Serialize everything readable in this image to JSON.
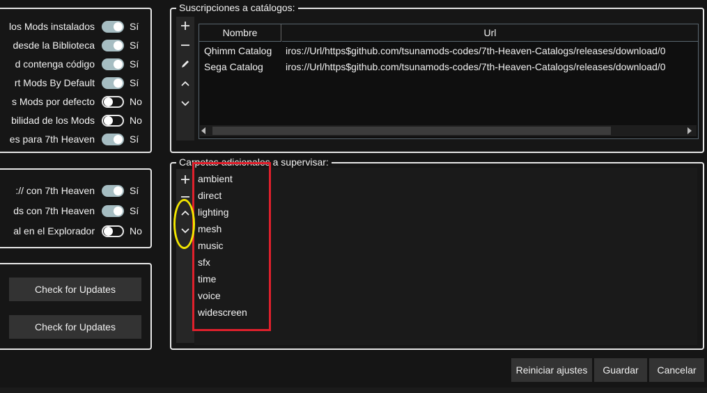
{
  "group1": {
    "rows": [
      {
        "label": "los Mods instalados",
        "on": true,
        "value": "Sí"
      },
      {
        "label": "desde la Biblioteca",
        "on": true,
        "value": "Sí"
      },
      {
        "label": "d contenga código",
        "on": true,
        "value": "Sí"
      },
      {
        "label": "rt Mods By Default",
        "on": true,
        "value": "Sí"
      },
      {
        "label": "s Mods por defecto",
        "on": false,
        "value": "No"
      },
      {
        "label": "bilidad de los Mods",
        "on": false,
        "value": "No"
      },
      {
        "label": "es para 7th Heaven",
        "on": true,
        "value": "Sí"
      }
    ]
  },
  "group2": {
    "rows": [
      {
        "label": ":// con 7th Heaven",
        "on": true,
        "value": "Sí"
      },
      {
        "label": "ds con 7th Heaven",
        "on": true,
        "value": "Sí"
      },
      {
        "label": "al en el Explorador",
        "on": false,
        "value": "No"
      }
    ]
  },
  "updates": {
    "button1": "Check for Updates",
    "button2": "Check for Updates"
  },
  "catalogs": {
    "title": "Suscripciones a catálogos:",
    "columns": [
      "Nombre",
      "Url"
    ],
    "rows": [
      {
        "name": "Qhimm Catalog",
        "url": "iros://Url/https$github.com/tsunamods-codes/7th-Heaven-Catalogs/releases/download/0"
      },
      {
        "name": "Sega Catalog",
        "url": "iros://Url/https$github.com/tsunamods-codes/7th-Heaven-Catalogs/releases/download/0"
      }
    ],
    "tools": {
      "add": "+",
      "remove": "−",
      "edit": "✎",
      "up": "⌃",
      "down": "⌄"
    }
  },
  "folders": {
    "title": "Carpetas adicionales a supervisar:",
    "items": [
      "ambient",
      "direct",
      "lighting",
      "mesh",
      "music",
      "sfx",
      "time",
      "voice",
      "widescreen"
    ],
    "tools": {
      "add": "+",
      "remove": "−",
      "up": "⌃",
      "down": "⌄"
    }
  },
  "footer": {
    "reset": "Reiniciar ajustes",
    "save": "Guardar",
    "cancel": "Cancelar"
  },
  "colors": {
    "toggle_on": "#a6bdc2",
    "highlight_red": "#e0202c",
    "highlight_yellow": "#f2e600"
  }
}
